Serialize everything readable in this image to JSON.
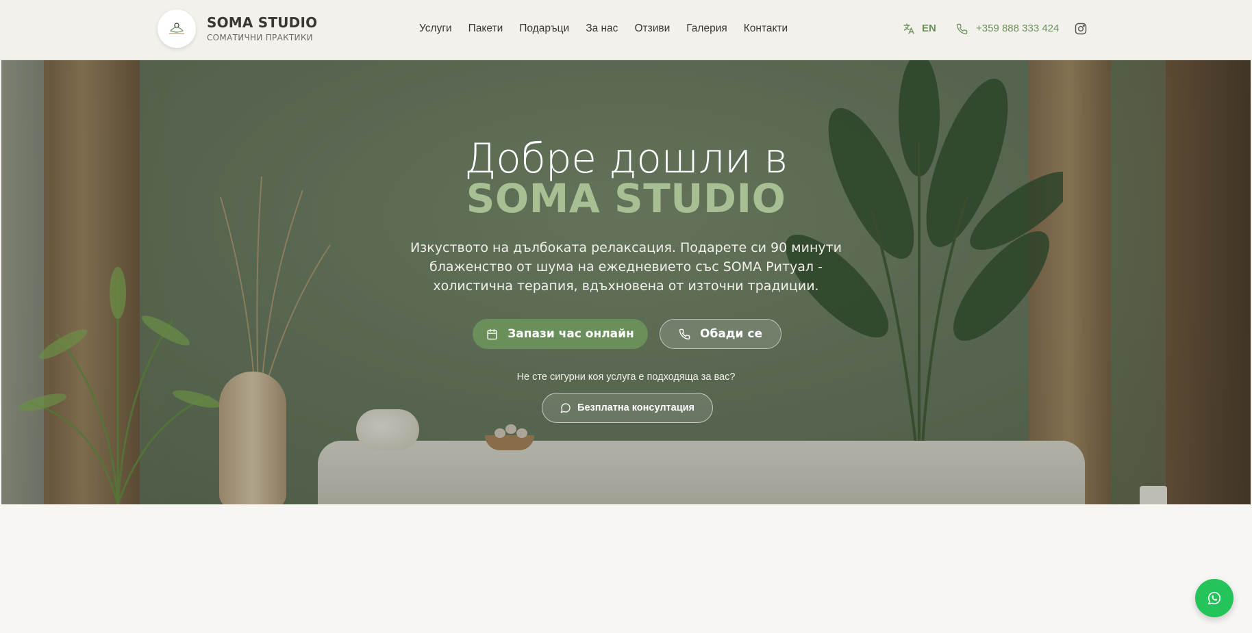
{
  "header": {
    "brand_title": "SOMA STUDIO",
    "brand_subtitle": "СОМАТИЧНИ ПРАКТИКИ",
    "nav": [
      "Услуги",
      "Пакети",
      "Подаръци",
      "За нас",
      "Отзиви",
      "Галерия",
      "Контакти"
    ],
    "language": "EN",
    "phone": "+359 888 333 424",
    "icons": {
      "language": "translate-icon",
      "phone": "phone-icon",
      "social": "instagram-icon"
    }
  },
  "hero": {
    "title": "Добре дошли в",
    "brand": "SOMA STUDIO",
    "description": "Изкуството на дълбоката релаксация. Подарете си 90 минути блаженство от шума на ежедневието със SOMA Ритуал - холистична терапия, вдъхновена от източни традиции.",
    "book_button": "Запази час онлайн",
    "call_button": "Обади се",
    "question": "Не сте сигурни коя услуга е подходяща за вас?",
    "consult_button": "Безплатна консултация"
  },
  "colors": {
    "accent_green": "#6b8f5a",
    "brand_highlight": "#a7bf93",
    "header_bg": "#f3f1eb",
    "whatsapp": "#25c45b"
  }
}
